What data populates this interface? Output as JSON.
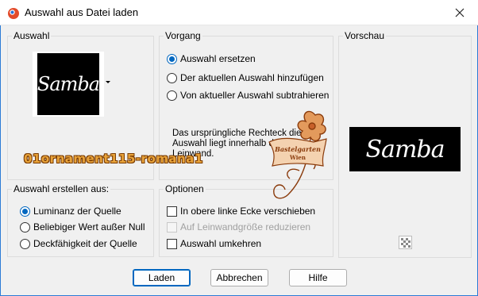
{
  "window": {
    "title": "Auswahl aus Datei laden",
    "close_icon": "close-icon",
    "app_icon": "paintshop-icon"
  },
  "auswahl": {
    "label": "Auswahl",
    "thumbnail_text": "Samba"
  },
  "vorgang": {
    "label": "Vorgang",
    "options": [
      {
        "label": "Auswahl ersetzen",
        "checked": true
      },
      {
        "label": "Der aktuellen Auswahl hinzufügen",
        "checked": false
      },
      {
        "label": "Von aktueller Auswahl subtrahieren",
        "checked": false
      }
    ],
    "info": "Das ursprüngliche Rechteck dieser Auswahl liegt innerhalb der Leinwand."
  },
  "vorschau": {
    "label": "Vorschau",
    "preview_text": "Samba"
  },
  "erstellen": {
    "label": "Auswahl erstellen aus:",
    "options": [
      {
        "label": "Luminanz der Quelle",
        "checked": true
      },
      {
        "label": "Beliebiger Wert außer Null",
        "checked": false
      },
      {
        "label": "Deckfähigkeit der Quelle",
        "checked": false
      }
    ]
  },
  "optionen": {
    "label": "Optionen",
    "items": [
      {
        "label": "In obere linke Ecke verschieben",
        "checked": false,
        "disabled": false
      },
      {
        "label": "Auf Leinwandgröße reduzieren",
        "checked": false,
        "disabled": true
      },
      {
        "label": "Auswahl umkehren",
        "checked": false,
        "disabled": false
      }
    ]
  },
  "watermark": {
    "text": "01ornament115-romana1",
    "badge_line1": "Bastelgarten",
    "badge_line2": "Wien"
  },
  "buttons": {
    "load": "Laden",
    "cancel": "Abbrechen",
    "help": "Hilfe"
  },
  "colors": {
    "accent": "#0067c0",
    "frame": "#2b7bd6",
    "watermark": "#e8a33a"
  }
}
